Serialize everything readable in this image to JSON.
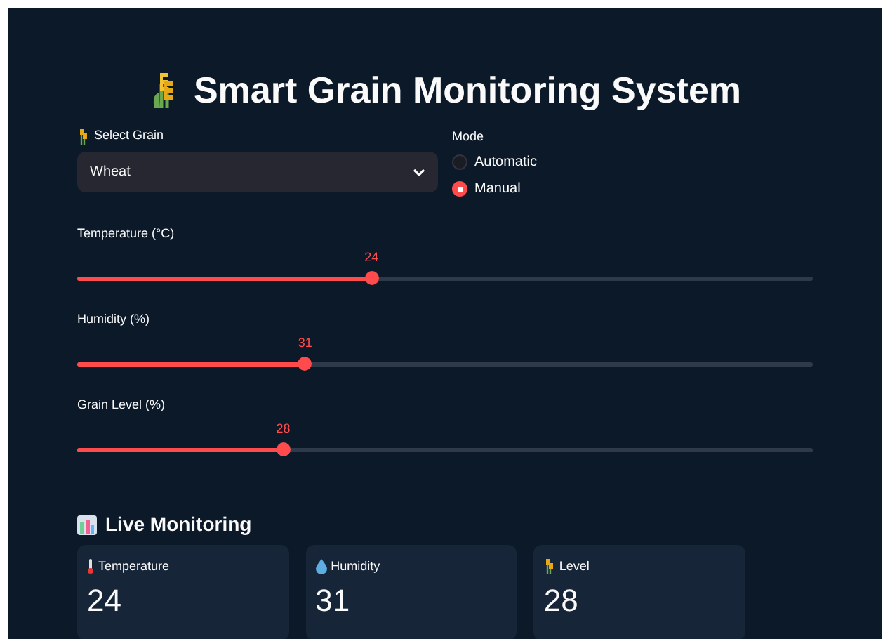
{
  "title": "Smart Grain Monitoring System",
  "grain_select": {
    "label": "Select Grain",
    "value": "Wheat"
  },
  "mode": {
    "label": "Mode",
    "options": [
      {
        "label": "Automatic",
        "selected": false
      },
      {
        "label": "Manual",
        "selected": true
      }
    ]
  },
  "sliders": [
    {
      "label": "Temperature (°C)",
      "reading": "24",
      "level": 0.4
    },
    {
      "label": "Humidity (%)",
      "reading": "31",
      "level": 0.31
    },
    {
      "label": "Grain Level (%)",
      "reading": "28",
      "level": 0.28
    }
  ],
  "live_monitoring": {
    "heading": "Live Monitoring",
    "metrics": [
      {
        "kind": "temperature",
        "label": "Temperature",
        "value": "24"
      },
      {
        "kind": "humidity",
        "label": "Humidity",
        "value": "31"
      },
      {
        "kind": "level",
        "label": "Level",
        "value": "28"
      }
    ]
  }
}
